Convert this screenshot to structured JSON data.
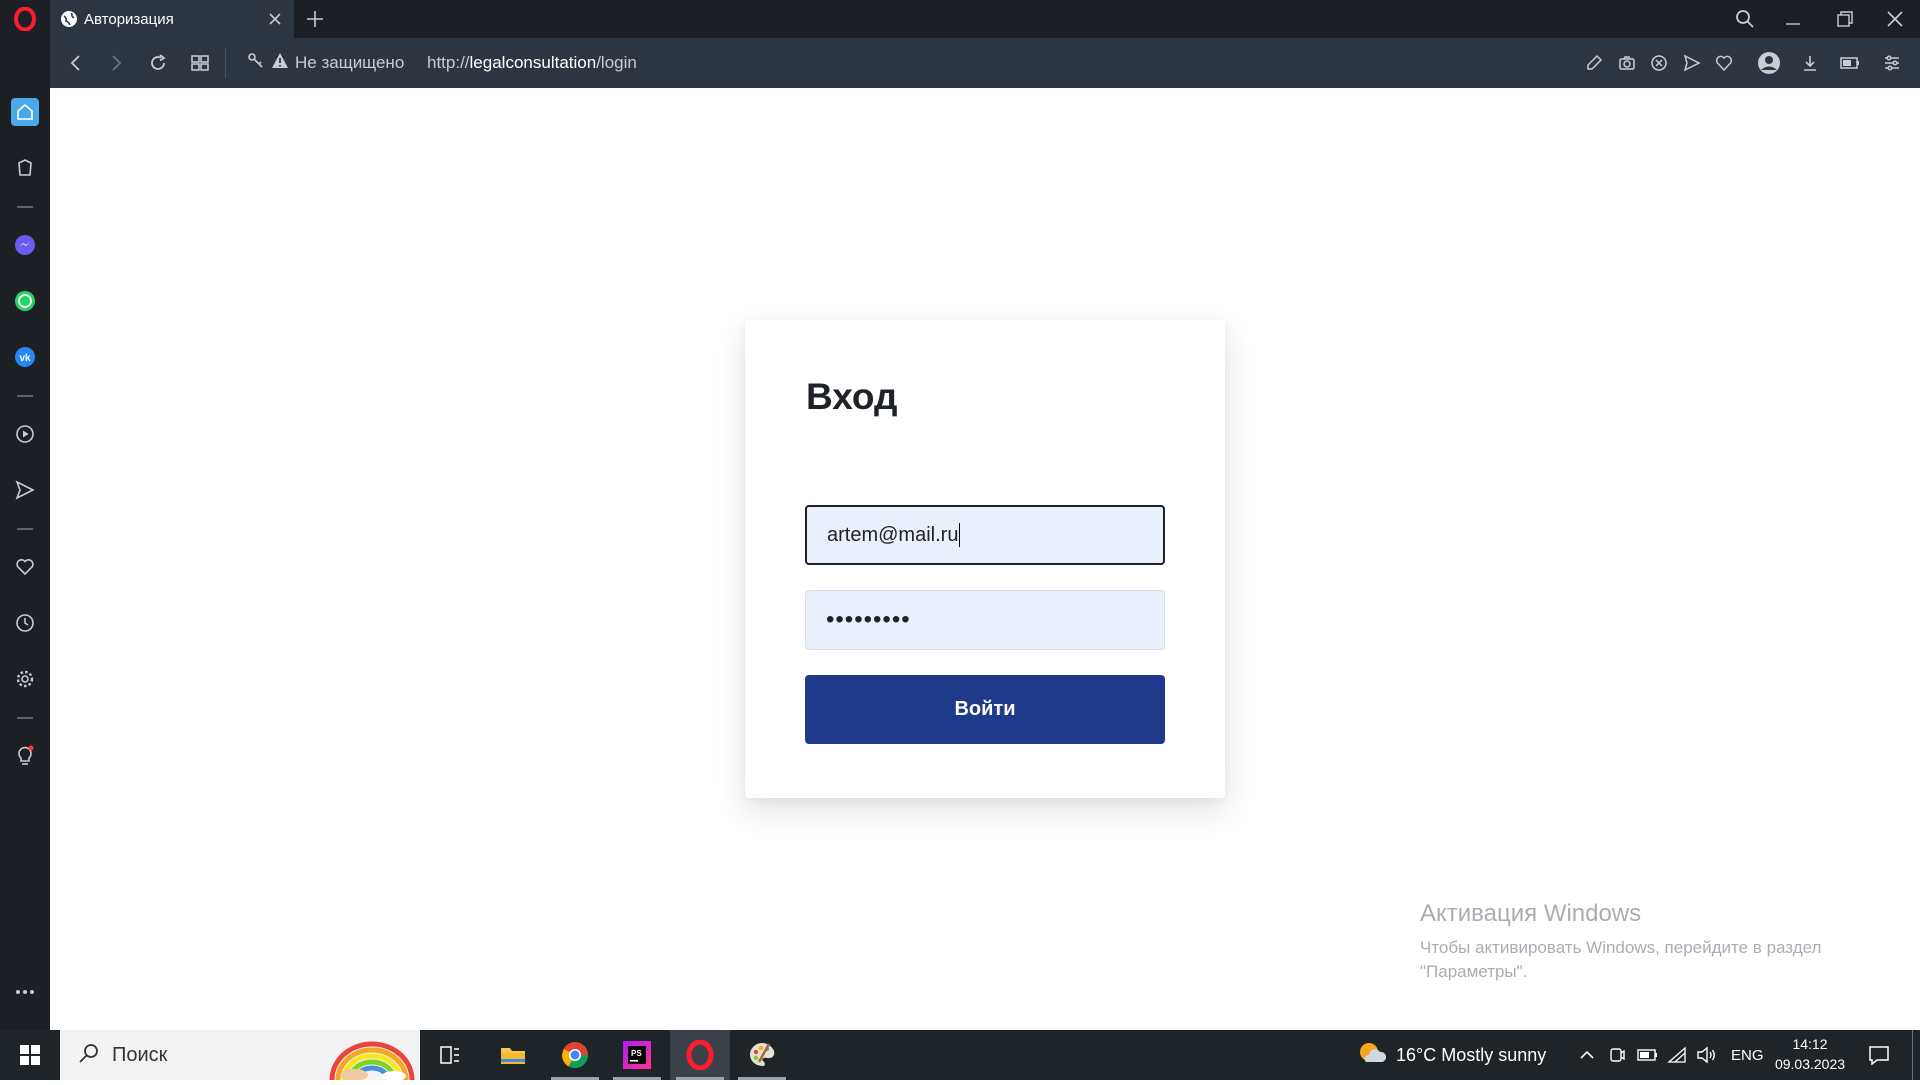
{
  "browser": {
    "tab_title": "Авторизация",
    "security_label": "Не защищено",
    "url_scheme": "http://",
    "url_host": "legalconsultation",
    "url_path": "/login"
  },
  "login": {
    "title": "Вход",
    "email_value": "artem@mail.ru",
    "password_masked": "•••••••••",
    "submit_label": "Войти"
  },
  "activation": {
    "title": "Активация Windows",
    "text": "Чтобы активировать Windows, перейдите в раздел \"Параметры\"."
  },
  "taskbar": {
    "search_placeholder": "Поиск",
    "weather": "16°C  Mostly sunny",
    "lang": "ENG",
    "time": "14:12",
    "date": "09.03.2023"
  },
  "colors": {
    "accent": "#1f3a8a",
    "input_bg": "#e9effb",
    "browser_dark": "#1c2024",
    "toolbar": "#2d3640"
  }
}
